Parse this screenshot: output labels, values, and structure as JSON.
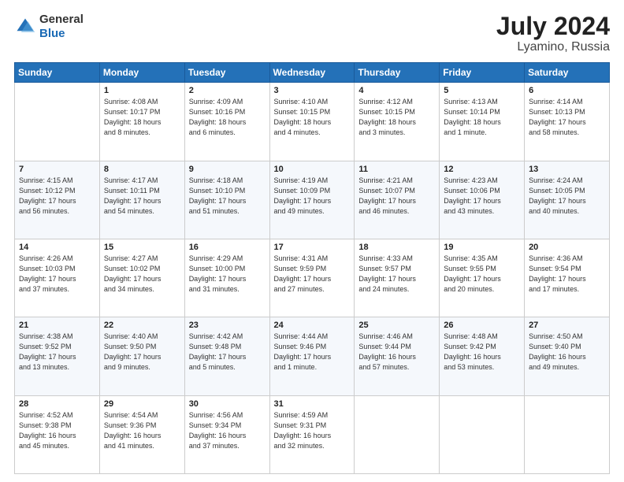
{
  "header": {
    "logo_line1": "General",
    "logo_line2": "Blue",
    "title": "July 2024",
    "subtitle": "Lyamino, Russia"
  },
  "weekdays": [
    "Sunday",
    "Monday",
    "Tuesday",
    "Wednesday",
    "Thursday",
    "Friday",
    "Saturday"
  ],
  "weeks": [
    [
      {
        "day": "",
        "info": ""
      },
      {
        "day": "1",
        "info": "Sunrise: 4:08 AM\nSunset: 10:17 PM\nDaylight: 18 hours\nand 8 minutes."
      },
      {
        "day": "2",
        "info": "Sunrise: 4:09 AM\nSunset: 10:16 PM\nDaylight: 18 hours\nand 6 minutes."
      },
      {
        "day": "3",
        "info": "Sunrise: 4:10 AM\nSunset: 10:15 PM\nDaylight: 18 hours\nand 4 minutes."
      },
      {
        "day": "4",
        "info": "Sunrise: 4:12 AM\nSunset: 10:15 PM\nDaylight: 18 hours\nand 3 minutes."
      },
      {
        "day": "5",
        "info": "Sunrise: 4:13 AM\nSunset: 10:14 PM\nDaylight: 18 hours\nand 1 minute."
      },
      {
        "day": "6",
        "info": "Sunrise: 4:14 AM\nSunset: 10:13 PM\nDaylight: 17 hours\nand 58 minutes."
      }
    ],
    [
      {
        "day": "7",
        "info": "Sunrise: 4:15 AM\nSunset: 10:12 PM\nDaylight: 17 hours\nand 56 minutes."
      },
      {
        "day": "8",
        "info": "Sunrise: 4:17 AM\nSunset: 10:11 PM\nDaylight: 17 hours\nand 54 minutes."
      },
      {
        "day": "9",
        "info": "Sunrise: 4:18 AM\nSunset: 10:10 PM\nDaylight: 17 hours\nand 51 minutes."
      },
      {
        "day": "10",
        "info": "Sunrise: 4:19 AM\nSunset: 10:09 PM\nDaylight: 17 hours\nand 49 minutes."
      },
      {
        "day": "11",
        "info": "Sunrise: 4:21 AM\nSunset: 10:07 PM\nDaylight: 17 hours\nand 46 minutes."
      },
      {
        "day": "12",
        "info": "Sunrise: 4:23 AM\nSunset: 10:06 PM\nDaylight: 17 hours\nand 43 minutes."
      },
      {
        "day": "13",
        "info": "Sunrise: 4:24 AM\nSunset: 10:05 PM\nDaylight: 17 hours\nand 40 minutes."
      }
    ],
    [
      {
        "day": "14",
        "info": "Sunrise: 4:26 AM\nSunset: 10:03 PM\nDaylight: 17 hours\nand 37 minutes."
      },
      {
        "day": "15",
        "info": "Sunrise: 4:27 AM\nSunset: 10:02 PM\nDaylight: 17 hours\nand 34 minutes."
      },
      {
        "day": "16",
        "info": "Sunrise: 4:29 AM\nSunset: 10:00 PM\nDaylight: 17 hours\nand 31 minutes."
      },
      {
        "day": "17",
        "info": "Sunrise: 4:31 AM\nSunset: 9:59 PM\nDaylight: 17 hours\nand 27 minutes."
      },
      {
        "day": "18",
        "info": "Sunrise: 4:33 AM\nSunset: 9:57 PM\nDaylight: 17 hours\nand 24 minutes."
      },
      {
        "day": "19",
        "info": "Sunrise: 4:35 AM\nSunset: 9:55 PM\nDaylight: 17 hours\nand 20 minutes."
      },
      {
        "day": "20",
        "info": "Sunrise: 4:36 AM\nSunset: 9:54 PM\nDaylight: 17 hours\nand 17 minutes."
      }
    ],
    [
      {
        "day": "21",
        "info": "Sunrise: 4:38 AM\nSunset: 9:52 PM\nDaylight: 17 hours\nand 13 minutes."
      },
      {
        "day": "22",
        "info": "Sunrise: 4:40 AM\nSunset: 9:50 PM\nDaylight: 17 hours\nand 9 minutes."
      },
      {
        "day": "23",
        "info": "Sunrise: 4:42 AM\nSunset: 9:48 PM\nDaylight: 17 hours\nand 5 minutes."
      },
      {
        "day": "24",
        "info": "Sunrise: 4:44 AM\nSunset: 9:46 PM\nDaylight: 17 hours\nand 1 minute."
      },
      {
        "day": "25",
        "info": "Sunrise: 4:46 AM\nSunset: 9:44 PM\nDaylight: 16 hours\nand 57 minutes."
      },
      {
        "day": "26",
        "info": "Sunrise: 4:48 AM\nSunset: 9:42 PM\nDaylight: 16 hours\nand 53 minutes."
      },
      {
        "day": "27",
        "info": "Sunrise: 4:50 AM\nSunset: 9:40 PM\nDaylight: 16 hours\nand 49 minutes."
      }
    ],
    [
      {
        "day": "28",
        "info": "Sunrise: 4:52 AM\nSunset: 9:38 PM\nDaylight: 16 hours\nand 45 minutes."
      },
      {
        "day": "29",
        "info": "Sunrise: 4:54 AM\nSunset: 9:36 PM\nDaylight: 16 hours\nand 41 minutes."
      },
      {
        "day": "30",
        "info": "Sunrise: 4:56 AM\nSunset: 9:34 PM\nDaylight: 16 hours\nand 37 minutes."
      },
      {
        "day": "31",
        "info": "Sunrise: 4:59 AM\nSunset: 9:31 PM\nDaylight: 16 hours\nand 32 minutes."
      },
      {
        "day": "",
        "info": ""
      },
      {
        "day": "",
        "info": ""
      },
      {
        "day": "",
        "info": ""
      }
    ]
  ]
}
